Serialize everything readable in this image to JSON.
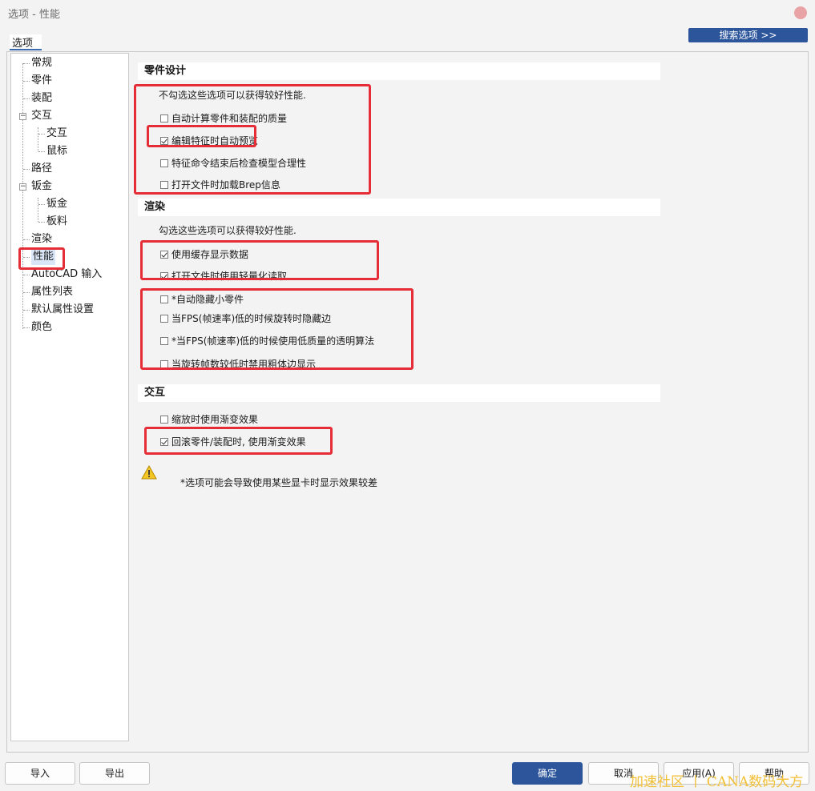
{
  "window": {
    "title": "选项 - 性能"
  },
  "tabs": {
    "options_label": "选项"
  },
  "search_button": "搜索选项 >>",
  "tree": {
    "general": "常规",
    "part": "零件",
    "assembly": "装配",
    "interaction": "交互",
    "interaction_child": "交互",
    "mouse": "鼠标",
    "path": "路径",
    "sheet_metal": "钣金",
    "sheet_metal_child": "钣金",
    "plate": "板料",
    "rendering": "渲染",
    "performance": "性能",
    "autocad_input": "AutoCAD 输入",
    "attribute_list": "属性列表",
    "default_attribute": "默认属性设置",
    "color": "颜色"
  },
  "part_design": {
    "header": "零件设计",
    "desc": "不勾选这些选项可以获得较好性能.",
    "options": [
      {
        "label": "自动计算零件和装配的质量",
        "checked": false
      },
      {
        "label": "编辑特征时自动预览",
        "checked": true
      },
      {
        "label": "特征命令结束后检查模型合理性",
        "checked": false
      },
      {
        "label": "打开文件时加载Brep信息",
        "checked": false
      }
    ]
  },
  "rendering": {
    "header": "渲染",
    "desc": "勾选这些选项可以获得较好性能.",
    "options": [
      {
        "label": "使用缓存显示数据",
        "checked": true
      },
      {
        "label": "打开文件时使用轻量化读取",
        "checked": true
      },
      {
        "label": "*自动隐藏小零件",
        "checked": false
      },
      {
        "label": "当FPS(帧速率)低的时候旋转时隐藏边",
        "checked": false
      },
      {
        "label": "*当FPS(帧速率)低的时候使用低质量的透明算法",
        "checked": false
      },
      {
        "label": "当旋转帧数较低时禁用粗体边显示",
        "checked": false
      }
    ]
  },
  "interaction": {
    "header": "交互",
    "options": [
      {
        "label": "缩放时使用渐变效果",
        "checked": false
      },
      {
        "label": "回滚零件/装配时, 使用渐变效果",
        "checked": true
      }
    ]
  },
  "note": "*选项可能会导致使用某些显卡时显示效果较差",
  "footer": {
    "import": "导入",
    "export": "导出",
    "ok": "确定",
    "cancel": "取消",
    "apply": "应用(A)",
    "help": "帮助"
  },
  "watermark": "加速社区 丨 CANA数码大方",
  "colors": {
    "accent": "#2c559c",
    "highlight": "#e52d37"
  }
}
